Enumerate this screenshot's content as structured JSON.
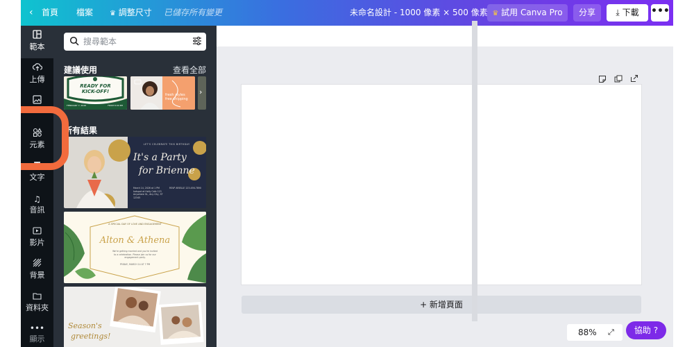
{
  "topbar": {
    "back_label": "首頁",
    "file_label": "檔案",
    "resize_label": "調整尺寸",
    "saved_status": "已儲存所有變更",
    "doc_title": "未命名設計 - 1000 像素 × 500 像素",
    "pro_label": "試用 Canva Pro",
    "share_label": "分享",
    "download_label": "下載",
    "more_label": "•••",
    "gradient_start": "#0fc3cf",
    "gradient_end": "#7b2ff2"
  },
  "rail": {
    "items": [
      {
        "label": "範本",
        "icon": "template-icon"
      },
      {
        "label": "上傳",
        "icon": "upload-icon"
      },
      {
        "label": "",
        "icon": "image-icon"
      },
      {
        "label": "元素",
        "icon": "elements-icon"
      },
      {
        "label": "文字",
        "icon": "text-icon"
      },
      {
        "label": "音訊",
        "icon": "music-icon"
      },
      {
        "label": "影片",
        "icon": "video-icon"
      },
      {
        "label": "背景",
        "icon": "background-icon"
      },
      {
        "label": "資料夾",
        "icon": "folder-icon"
      },
      {
        "label": "顯示",
        "icon": "more-icon"
      }
    ],
    "highlight_color": "#f26b3d"
  },
  "panel": {
    "search_placeholder": "搜尋範本",
    "suggested_title": "建議使用",
    "see_all": "查看全部",
    "all_results_title": "所有結果",
    "suggested": [
      {
        "line1": "READY FOR",
        "line2": "KICK-OFF!",
        "footer_left": "FEBRUARY 7, 2026",
        "footer_right": "FROM 8:00 PM"
      },
      {
        "text": "fresh styles free shipping"
      }
    ],
    "results": [
      {
        "header": "LET'S CELEBRATE THIS BIRTHDAY",
        "script_line1": "It's a Party",
        "script_line2": "for Brienne",
        "detail_left": "March 14, 2026 at 1 PM hotspot at Holly Cafe 123 Anywhere St., Any City, ST 12345",
        "detail_right": "RSVP ARIELLE 123-456-7890"
      },
      {
        "header": "A SPECIAL DAY OF LOVE AND ENGAGEMENT",
        "script": "Alton & Athena",
        "body": "We're getting married and you're invited to a celebration. Please join us for our engagement party.",
        "footer": "FRIDAY, MARCH 14 AT 7 PM"
      },
      {
        "script_line1": "Season's",
        "script_line2": "greetings!"
      }
    ]
  },
  "workspace": {
    "add_page_label": "+ 新增頁面",
    "zoom_label": "88%",
    "help_label": "協助 ?",
    "help_color": "#7d2ae8"
  }
}
